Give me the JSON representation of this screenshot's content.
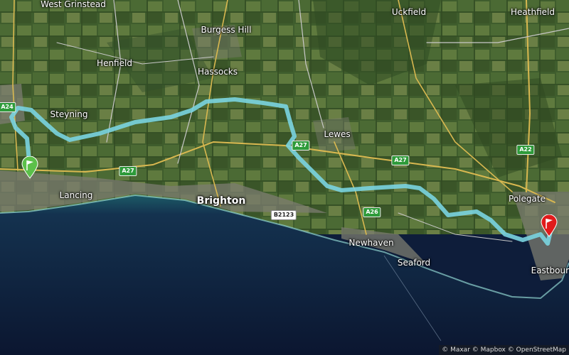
{
  "map": {
    "colors": {
      "land": "#3d5a2c",
      "sea": "#0e1d3a",
      "shallow": "#1f6f73",
      "roads_major": "#d9b850",
      "roads_minor": "#c8c8c8",
      "urban": "#7a7a70",
      "route": "#7ad4e0",
      "start_marker": "#5cc04a",
      "end_marker": "#e11b1b"
    },
    "places": {
      "west_grinstead": "West Grinstead",
      "uckfield": "Uckfield",
      "heathfield": "Heathfield",
      "burgess_hill": "Burgess Hill",
      "henfield": "Henfield",
      "hassocks": "Hassocks",
      "steyning": "Steyning",
      "lewes": "Lewes",
      "lancing": "Lancing",
      "brighton": "Brighton",
      "polegate": "Polegate",
      "newhaven": "Newhaven",
      "seaford": "Seaford",
      "eastbourne": "Eastbour"
    },
    "road_shields": {
      "a24": "A24",
      "a27_west": "A27",
      "a27_lewes": "A27",
      "a27_east": "A27",
      "a22": "A22",
      "a26": "A26",
      "b2123": "B2123"
    },
    "markers": {
      "start_icon": "green-flag-pin",
      "end_icon": "red-flag-pin"
    },
    "attribution": "© Maxar © Mapbox © OpenStreetMap"
  }
}
